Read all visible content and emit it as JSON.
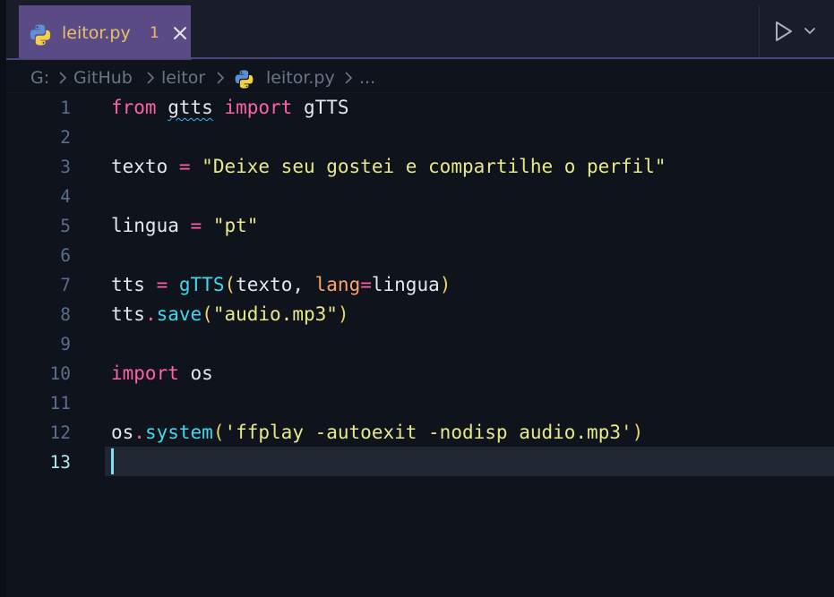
{
  "tab": {
    "title": "leitor.py",
    "badge": "1",
    "icon": "python-icon",
    "close_icon": "close-icon"
  },
  "toolbar": {
    "run_icon": "play-icon",
    "run_menu_icon": "chevron-down-icon"
  },
  "breadcrumb": {
    "items": [
      "G:",
      "GitHub",
      "leitor",
      "leitor.py",
      "..."
    ]
  },
  "editor": {
    "active_line": 13,
    "line_numbers": [
      "1",
      "2",
      "3",
      "4",
      "5",
      "6",
      "7",
      "8",
      "9",
      "10",
      "11",
      "12",
      "13"
    ],
    "lines": [
      [
        {
          "t": "from",
          "c": "kw"
        },
        {
          "t": " ",
          "c": "var"
        },
        {
          "t": "gtts",
          "c": "var",
          "squiggle": true
        },
        {
          "t": " ",
          "c": "var"
        },
        {
          "t": "import",
          "c": "kw"
        },
        {
          "t": " gTTS",
          "c": "var"
        }
      ],
      [],
      [
        {
          "t": "texto ",
          "c": "var"
        },
        {
          "t": "=",
          "c": "op"
        },
        {
          "t": " ",
          "c": "var"
        },
        {
          "t": "\"Deixe seu gostei e compartilhe o perfil\"",
          "c": "str"
        }
      ],
      [],
      [
        {
          "t": "lingua ",
          "c": "var"
        },
        {
          "t": "=",
          "c": "op"
        },
        {
          "t": " ",
          "c": "var"
        },
        {
          "t": "\"pt\"",
          "c": "str"
        }
      ],
      [],
      [
        {
          "t": "tts ",
          "c": "var"
        },
        {
          "t": "=",
          "c": "op"
        },
        {
          "t": " ",
          "c": "var"
        },
        {
          "t": "gTTS",
          "c": "fn"
        },
        {
          "t": "(",
          "c": "paren"
        },
        {
          "t": "texto, ",
          "c": "var"
        },
        {
          "t": "lang",
          "c": "param"
        },
        {
          "t": "=",
          "c": "op"
        },
        {
          "t": "lingua",
          "c": "var"
        },
        {
          "t": ")",
          "c": "paren"
        }
      ],
      [
        {
          "t": "tts",
          "c": "var"
        },
        {
          "t": ".",
          "c": "op"
        },
        {
          "t": "save",
          "c": "fn"
        },
        {
          "t": "(",
          "c": "paren"
        },
        {
          "t": "\"audio.mp3\"",
          "c": "str"
        },
        {
          "t": ")",
          "c": "paren"
        }
      ],
      [],
      [
        {
          "t": "import",
          "c": "kw"
        },
        {
          "t": " os",
          "c": "var"
        }
      ],
      [],
      [
        {
          "t": "os",
          "c": "var"
        },
        {
          "t": ".",
          "c": "op"
        },
        {
          "t": "system",
          "c": "fn"
        },
        {
          "t": "(",
          "c": "paren"
        },
        {
          "t": "'ffplay -autoexit -nodisp audio.mp3'",
          "c": "str"
        },
        {
          "t": ")",
          "c": "paren"
        }
      ],
      []
    ]
  },
  "colors": {
    "background": "#0e131c",
    "tab_active": "#5a4a86",
    "tab_text": "#e8c06a",
    "keyword": "#ff5ea8",
    "string": "#e9e98a",
    "function": "#3fd8ee",
    "parameter": "#ffa36b"
  }
}
